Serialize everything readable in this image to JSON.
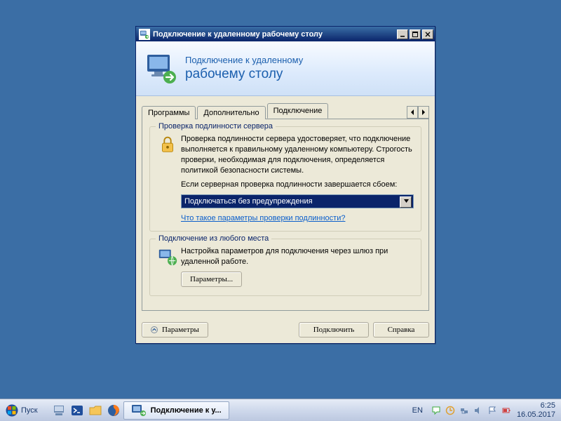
{
  "window": {
    "title": "Подключение к удаленному рабочему столу",
    "banner": {
      "line1": "Подключение к удаленному",
      "line2": "рабочему столу"
    },
    "tabs": [
      {
        "label": "Программы",
        "active": false
      },
      {
        "label": "Дополнительно",
        "active": false
      },
      {
        "label": "Подключение",
        "active": true
      }
    ],
    "group_auth": {
      "title": "Проверка подлинности сервера",
      "para1": "Проверка подлинности сервера удостоверяет, что подключение выполняется к правильному удаленному компьютеру. Строгость проверки, необходимая для подключения, определяется политикой безопасности системы.",
      "para2": "Если серверная проверка подлинности завершается сбоем:",
      "combo_value": "Подключаться без предупреждения",
      "link": "Что такое параметры проверки подлинности?"
    },
    "group_gateway": {
      "title": "Подключение из любого места",
      "para": "Настройка параметров для подключения через шлюз при удаленной работе.",
      "button": "Параметры..."
    },
    "buttons": {
      "options": "Параметры",
      "connect": "Подключить",
      "help": "Справка"
    }
  },
  "taskbar": {
    "start": "Пуск",
    "task_label": "Подключение к у...",
    "lang": "EN",
    "clock_time": "6:25",
    "clock_date": "16.05.2017"
  }
}
